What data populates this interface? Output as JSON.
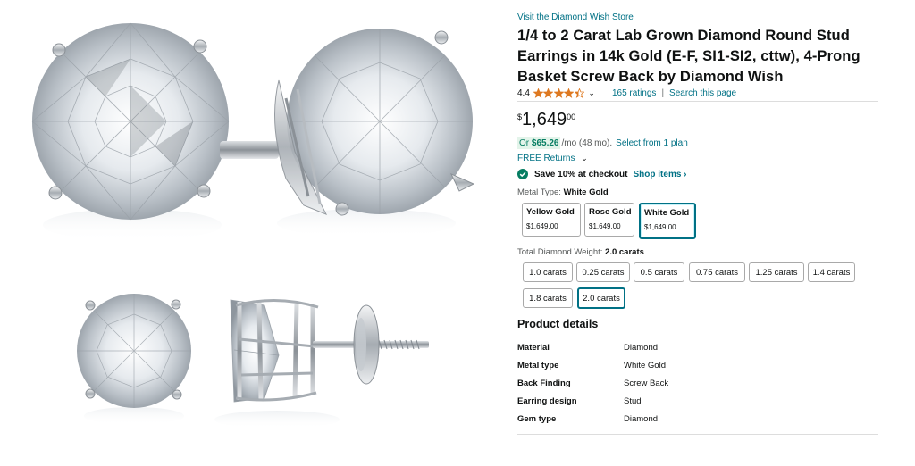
{
  "store": {
    "link_text": "Visit the Diamond Wish Store"
  },
  "product": {
    "title": "1/4 to 2 Carat Lab Grown Diamond Round Stud Earrings in 14k Gold (E-F, SI1-SI2, cttw), 4-Prong Basket Screw Back by Diamond Wish"
  },
  "rating": {
    "value": "4.4",
    "stars": 4.4,
    "ratings_text": "165 ratings",
    "separator": "|",
    "search_text": "Search this page"
  },
  "price": {
    "symbol": "$",
    "whole": "1,649",
    "fraction": "00"
  },
  "monthly": {
    "or": "Or",
    "amount": "$65.26",
    "rest": "/mo (48 mo).",
    "link": "Select from 1 plan"
  },
  "returns": {
    "text": "FREE Returns"
  },
  "savings": {
    "text": "Save 10% at checkout",
    "link": "Shop items ›"
  },
  "metal": {
    "label": "Metal Type:",
    "selected": "White Gold",
    "options": [
      {
        "name": "Yellow Gold",
        "price": "$1,649.00"
      },
      {
        "name": "Rose Gold",
        "price": "$1,649.00"
      },
      {
        "name": "White Gold",
        "price": "$1,649.00"
      }
    ]
  },
  "weight": {
    "label": "Total Diamond Weight:",
    "selected": "2.0 carats",
    "options": [
      "1.0 carats",
      "0.25 carats",
      "0.5 carats",
      "0.75 carats",
      "1.25 carats",
      "1.4 carats",
      "1.8 carats",
      "2.0 carats"
    ]
  },
  "details": {
    "heading": "Product details",
    "rows": [
      {
        "key": "Material",
        "value": "Diamond"
      },
      {
        "key": "Metal type",
        "value": "White Gold"
      },
      {
        "key": "Back Finding",
        "value": "Screw Back"
      },
      {
        "key": "Earring design",
        "value": "Stud"
      },
      {
        "key": "Gem type",
        "value": "Diamond"
      }
    ]
  },
  "colors": {
    "link": "#007185",
    "star": "#de7921",
    "selected_border": "#007185",
    "save_green": "#067d62"
  },
  "icons": {
    "gallery": "earring-product-photo",
    "star": "star-icon",
    "chevron": "chevron-down-icon",
    "check": "check-circle-icon"
  }
}
